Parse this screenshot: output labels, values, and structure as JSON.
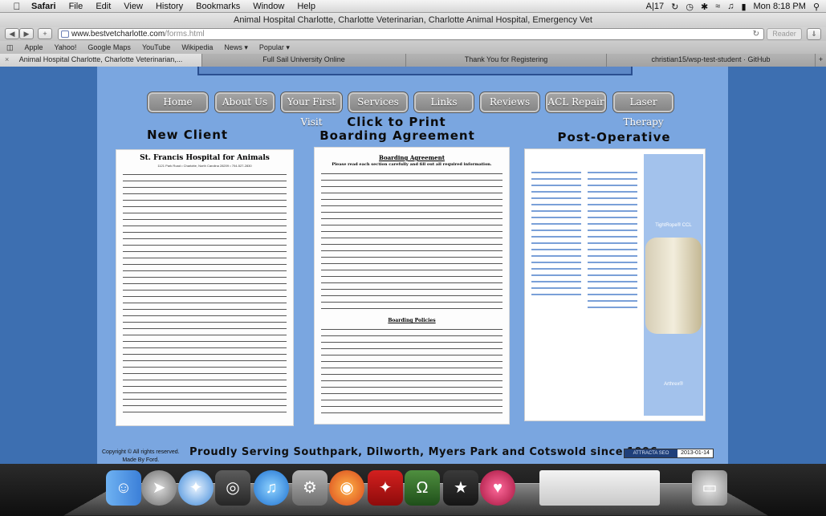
{
  "menubar": {
    "app": "Safari",
    "items": [
      "File",
      "Edit",
      "View",
      "History",
      "Bookmarks",
      "Window",
      "Help"
    ],
    "status": {
      "input": "17",
      "clock": "Mon 8:18 PM"
    }
  },
  "window": {
    "title": "Animal Hospital Charlotte, Charlotte Veterinarian, Charlotte Animal Hospital, Emergency Vet"
  },
  "toolbar": {
    "url_domain": "www.bestvetcharlotte.com",
    "url_path": "/forms.html",
    "reader_label": "Reader"
  },
  "bookmarks": [
    "Apple",
    "Yahoo!",
    "Google Maps",
    "YouTube",
    "Wikipedia",
    "News ▾",
    "Popular ▾"
  ],
  "tabs": [
    {
      "label": "Animal Hospital Charlotte, Charlotte Veterinarian,...",
      "active": true
    },
    {
      "label": "Full Sail University Online",
      "active": false
    },
    {
      "label": "Thank You for Registering",
      "active": false
    },
    {
      "label": "christian15/wsp-test-student · GitHub",
      "active": false
    }
  ],
  "site": {
    "nav": [
      "Home",
      "About Us",
      "Your First Visit",
      "Services",
      "Links",
      "Reviews",
      "ACL Repair",
      "Laser Therapy"
    ],
    "click_to_print": "Click to Print",
    "columns": {
      "new_client": "New Client",
      "boarding": "Boarding Agreement",
      "post_op": "Post-Operative"
    },
    "new_client_doc": {
      "heading": "St. Francis Hospital for Animals",
      "sub": "1121 Park Road • Charlotte, North Carolina 28209 • 704-527-2830"
    },
    "boarding_doc": {
      "heading": "Boarding Agreement",
      "sub": "Please read each section carefully and fill out all required information.",
      "policies": "Boarding Policies"
    },
    "post_op_doc": {
      "title": "TightRope® CCL",
      "footer": "Arthrex®"
    },
    "footer": {
      "copyright": "Copyright © All rights reserved.",
      "made_by": "Made By Ford.",
      "tagline": "Proudly Serving Southpark, Dilworth, Myers Park and Cotswold since 1996",
      "badge_left": "ATTRACTA SEO",
      "badge_date": "2013-01-14"
    }
  },
  "dock": [
    "finder-icon",
    "launchpad-icon",
    "safari-icon",
    "facetime-icon",
    "itunes-icon",
    "system-preferences-icon",
    "firefox-icon",
    "acrobat-icon",
    "dreamweaver-icon",
    "github-icon",
    "app-icon",
    "documents-icon",
    "trash-icon"
  ]
}
